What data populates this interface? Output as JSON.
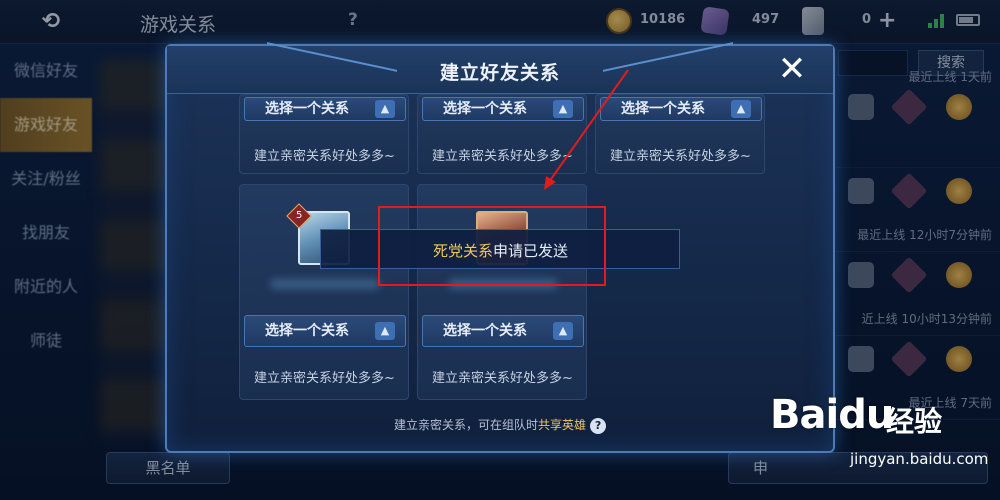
{
  "topbar": {
    "back_label": "⟲",
    "title": "游戏关系",
    "help_label": "?",
    "coins": "10186",
    "gems": "497",
    "cards": "0",
    "plus_label": "+"
  },
  "sidebar": {
    "items": [
      {
        "label": "微信好友"
      },
      {
        "label": "游戏好友"
      },
      {
        "label": "关注/粉丝"
      },
      {
        "label": "找朋友"
      },
      {
        "label": "附近的人"
      },
      {
        "label": "师徒"
      }
    ]
  },
  "background": {
    "blacklist_label": "黑名单",
    "search_label": "搜索",
    "right_button_label": "申",
    "friends": [
      {
        "status": "最近上线  1天前"
      },
      {
        "status": "最近上线  12小时7分钟前"
      },
      {
        "status": "近上线  10小时13分钟前"
      },
      {
        "status": "最近上线  7天前"
      }
    ]
  },
  "modal": {
    "title": "建立好友关系",
    "close_label": "✕",
    "top_cards": [
      {
        "select_label": "选择一个关系",
        "desc": "建立亲密关系好处多多~"
      },
      {
        "select_label": "选择一个关系",
        "desc": "建立亲密关系好处多多~"
      },
      {
        "select_label": "选择一个关系",
        "desc": "建立亲密关系好处多多~"
      }
    ],
    "bottom_cards": [
      {
        "hero_level": "5",
        "select_label": "选择一个关系",
        "desc": "建立亲密关系好处多多~"
      },
      {
        "select_label": "选择一个关系",
        "desc": "建立亲密关系好处多多~"
      }
    ],
    "footer_prefix": "建立亲密关系，可在组队时",
    "footer_highlight": "共享英雄",
    "footer_help": "?"
  },
  "toast": {
    "highlight": "死党关系",
    "text": "申请已发送"
  },
  "watermark": {
    "logo": "Bai",
    "logo_paw": "du",
    "brand": "经验",
    "url": "jingyan.baidu.com"
  },
  "colors": {
    "accent_gold": "#f0c85a",
    "annotation_red": "#e21b1b",
    "panel_border": "#4e7bb6"
  }
}
